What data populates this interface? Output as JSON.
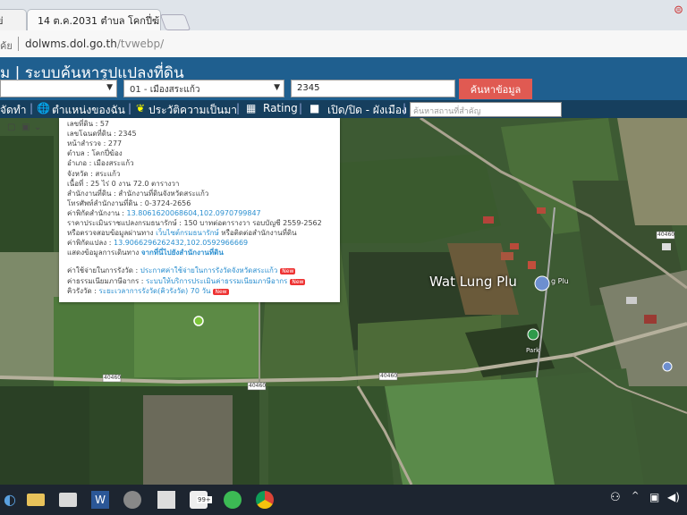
{
  "browser": {
    "tab1_label": "ย่",
    "tab2_label": "14 ต.ค.2031 ตำบล โคกปี่ฆ้อ",
    "address_prefix": "ค้ย",
    "url_host": "dolwms.dol.go.th",
    "url_path": "/tvwebp/"
  },
  "app": {
    "title": "ม | ระบบค้นหารูปแปลงที่ดิน",
    "district_select": "01 - เมืองสระแก้ว",
    "parcel_input_value": "2345",
    "search_button": "ค้นหาข้อมูล"
  },
  "toolbar": {
    "item1": "จัดทำ",
    "item2": "ตำแหน่งของฉัน",
    "item3": "ประวัติความเป็นมา",
    "item4": "Rating",
    "item5": "เปิด/ปิด - ผังเมือง",
    "place_search_placeholder": "ค้นหาสถานที่สำคัญ"
  },
  "popup": {
    "lines": [
      "เลขที่ดิน : 57",
      "เลขโฉนดที่ดิน : 2345",
      "หน้าสำรวจ : 277",
      "ตำบล : โคกปี่ฆ้อง",
      "อำเภอ : เมืองสระแก้ว",
      "จังหวัด : สระแก้ว",
      "เนื้อที่ : 25 ไร่ 0 งาน 72.0 ตารางวา",
      "สำนักงานที่ดิน : สำนักงานที่ดินจังหวัดสระแก้ว",
      "โทรศัพท์สำนักงานที่ดิน : 0-3724-2656"
    ],
    "office_coord_label": "ค่าพิกัดสำนักงาน : ",
    "office_coord_value": "13.8061620068604,102.0970799847",
    "price_line": "ราคาประเมินราชแปลงกรมธนารักษ์ : 150 บาทต่อตารางวา รอบบัญชี 2559-2562",
    "verify_prefix": "หรือตรวจสอบข้อมูลผ่านทาง ",
    "verify_link": "เว็บไซต์กรมธนารักษ์",
    "verify_suffix": " หรือติดต่อสำนักงานที่ดิน",
    "parcel_coord_label": "ค่าพิกัดแปลง : ",
    "parcel_coord_value": "13.9066296262432,102.0592966669",
    "route_prefix": "แสดงข้อมูลการเดินทาง ",
    "route_link": "จากที่นี่ไปยังสำนักงานที่ดิน",
    "fee1_label": "ค่าใช้จ่ายในการรังวัด : ",
    "fee1_link": "ประกาศค่าใช้จ่ายในการรังวัดจังหวัดสระแก้ว",
    "fee2_label": "ค่าธรรมเนียมภาษีอากร : ",
    "fee2_link": "ระบบให้บริการประเมินค่าธรรมเนียมภาษีอากร",
    "fee3_label": "คิวรังวัด : ",
    "fee3_value": "ระยะเวลาการรังวัด(คิวรังวัด) 70 วัน",
    "new_badge": "New"
  },
  "map": {
    "place_label": "Wat Lung Plu",
    "place_label_partial": "g Plu",
    "road_shields": [
      "40460",
      "40460",
      "40460",
      "40460"
    ],
    "park_label": "Park"
  },
  "taskbar": {
    "badge": "99+"
  }
}
